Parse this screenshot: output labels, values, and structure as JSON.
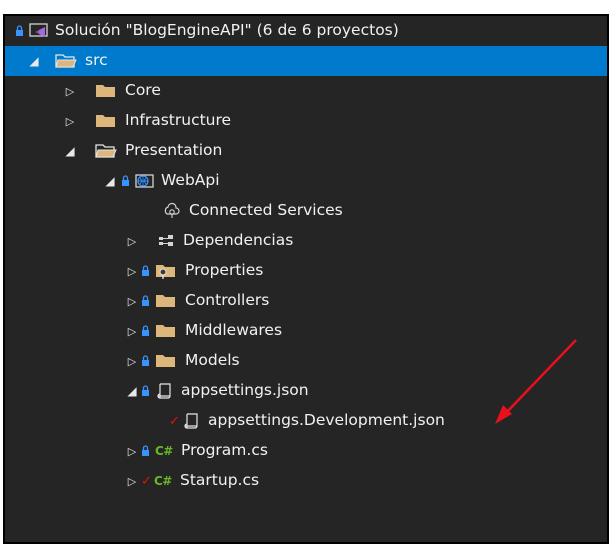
{
  "solution": {
    "label": "Solución \"BlogEngineAPI\" (6 de 6 proyectos)",
    "icon": "solution-icon",
    "status_icon": "lock-icon"
  },
  "tree": {
    "src": {
      "label": "src",
      "icon": "folder-open-icon",
      "arrow": "expanded"
    },
    "core": {
      "label": "Core",
      "icon": "folder-icon",
      "arrow": "collapsed"
    },
    "infrastructure": {
      "label": "Infrastructure",
      "icon": "folder-icon",
      "arrow": "collapsed"
    },
    "presentation": {
      "label": "Presentation",
      "icon": "folder-open-icon",
      "arrow": "expanded"
    },
    "webapi": {
      "label": "WebApi",
      "icon": "web-project-icon",
      "arrow": "expanded"
    },
    "connected_services": {
      "label": "Connected Services",
      "icon": "connected-services-icon"
    },
    "dependencies": {
      "label": "Dependencias",
      "icon": "dependencies-icon",
      "arrow": "collapsed"
    },
    "properties": {
      "label": "Properties",
      "icon": "properties-folder-icon",
      "arrow": "collapsed"
    },
    "controllers": {
      "label": "Controllers",
      "icon": "folder-icon",
      "arrow": "collapsed"
    },
    "middlewares": {
      "label": "Middlewares",
      "icon": "folder-icon",
      "arrow": "collapsed"
    },
    "models": {
      "label": "Models",
      "icon": "folder-icon",
      "arrow": "collapsed"
    },
    "appsettings": {
      "label": "appsettings.json",
      "icon": "json-file-icon",
      "arrow": "expanded"
    },
    "appsettings_dev": {
      "label": "appsettings.Development.json",
      "icon": "json-file-icon",
      "status": "modified-check"
    },
    "program": {
      "label": "Program.cs",
      "icon": "csharp-file-icon",
      "icon_text": "C#",
      "arrow": "collapsed"
    },
    "startup": {
      "label": "Startup.cs",
      "icon": "csharp-file-icon",
      "icon_text": "C#",
      "arrow": "collapsed",
      "status": "modified-check"
    }
  },
  "colors": {
    "background": "#252526",
    "selection": "#007acc",
    "text": "#f1f1f1",
    "folder": "#dcb67a",
    "lock": "#1e90ff",
    "modified": "#e51400",
    "csharp": "#68b723",
    "annotation_arrow": "#e8101b"
  },
  "glyphs": {
    "collapsed": "▷",
    "expanded": "◢",
    "check": "✓"
  }
}
